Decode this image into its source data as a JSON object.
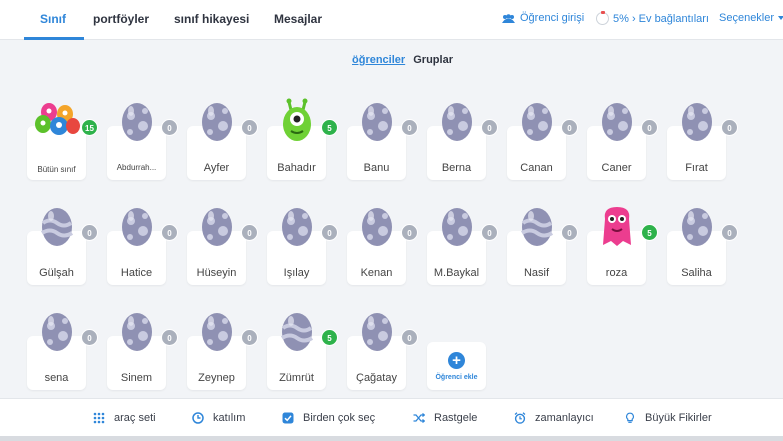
{
  "nav": {
    "tabs": [
      "Sınıf",
      "portföyler",
      "sınıf hikayesi",
      "Mesajlar"
    ],
    "student_login": "Öğrenci girişi",
    "home_connection": "5% › Ev bağlantıları",
    "options": "Seçenekler",
    "home_connection_percent": 5
  },
  "subtabs": {
    "students": "öğrenciler",
    "groups": "Gruplar"
  },
  "students": [
    {
      "name": "Bütün sınıf",
      "points": "15",
      "avatar": "class-group-icon"
    },
    {
      "name": "Abdurrah...",
      "points": "0",
      "avatar": "egg-avatar"
    },
    {
      "name": "Ayfer",
      "points": "0",
      "avatar": "egg-avatar"
    },
    {
      "name": "Bahadır",
      "points": "5",
      "avatar": "green-monster-avatar"
    },
    {
      "name": "Banu",
      "points": "0",
      "avatar": "egg-avatar"
    },
    {
      "name": "Berna",
      "points": "0",
      "avatar": "egg-avatar"
    },
    {
      "name": "Canan",
      "points": "0",
      "avatar": "egg-avatar"
    },
    {
      "name": "Caner",
      "points": "0",
      "avatar": "egg-avatar"
    },
    {
      "name": "Fırat",
      "points": "0",
      "avatar": "egg-avatar"
    },
    {
      "name": "Gülşah",
      "points": "0",
      "avatar": "egg-avatar"
    },
    {
      "name": "Hatice",
      "points": "0",
      "avatar": "egg-avatar"
    },
    {
      "name": "Hüseyin",
      "points": "0",
      "avatar": "egg-avatar"
    },
    {
      "name": "Işılay",
      "points": "0",
      "avatar": "egg-avatar"
    },
    {
      "name": "Kenan",
      "points": "0",
      "avatar": "egg-avatar"
    },
    {
      "name": "M.Baykal",
      "points": "0",
      "avatar": "egg-avatar"
    },
    {
      "name": "Nasif",
      "points": "0",
      "avatar": "egg-avatar"
    },
    {
      "name": "roza",
      "points": "5",
      "avatar": "pink-monster-avatar"
    },
    {
      "name": "Saliha",
      "points": "0",
      "avatar": "egg-avatar"
    },
    {
      "name": "sena",
      "points": "0",
      "avatar": "egg-avatar"
    },
    {
      "name": "Sinem",
      "points": "0",
      "avatar": "egg-avatar"
    },
    {
      "name": "Zeynep",
      "points": "0",
      "avatar": "egg-avatar"
    },
    {
      "name": "Zümrüt",
      "points": "5",
      "avatar": "egg-avatar"
    },
    {
      "name": "Çağatay",
      "points": "0",
      "avatar": "egg-avatar"
    }
  ],
  "add_student": "Öğrenci ekle",
  "toolbar": {
    "toolkit": "araç seti",
    "attendance": "katılım",
    "multi_select": "Birden çok seç",
    "random": "Rastgele",
    "timer": "zamanlayıcı",
    "big_ideas": "Büyük Fikirler"
  },
  "colors": {
    "accent": "#2f86d9",
    "points_positive": "#2eb24b",
    "points_zero": "#aab0bc"
  }
}
